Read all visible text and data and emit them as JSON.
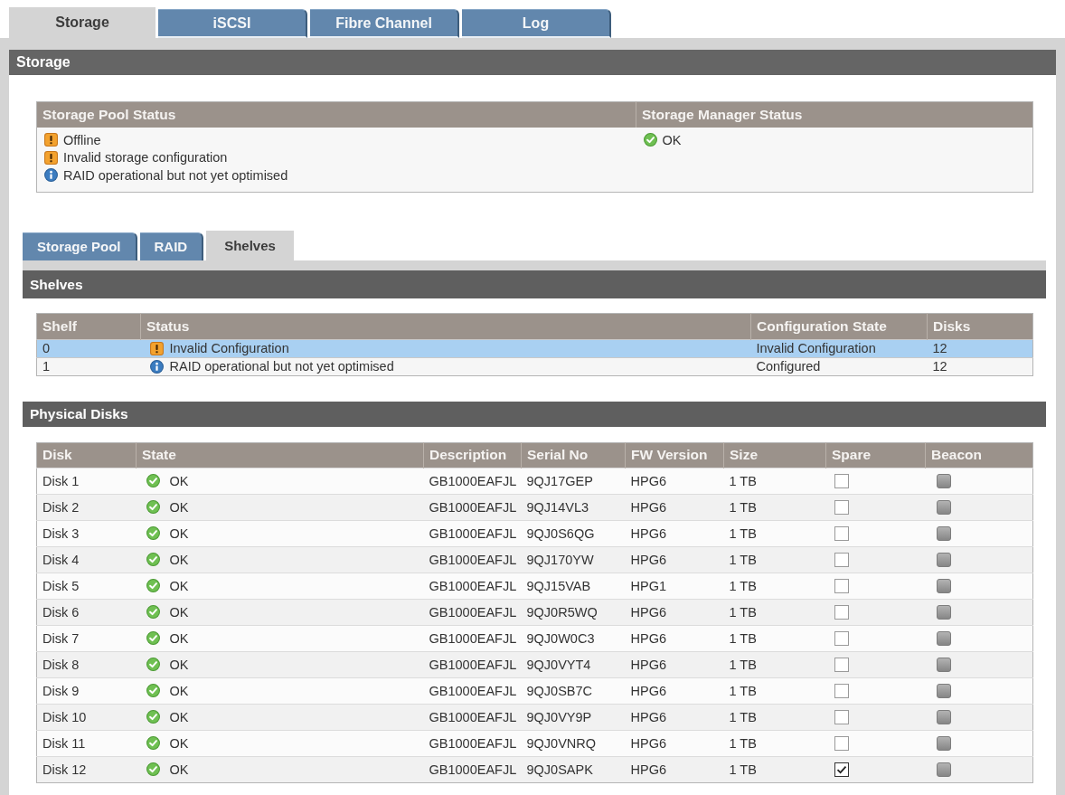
{
  "tabs": [
    {
      "label": "Storage",
      "selected": true
    },
    {
      "label": "iSCSI",
      "selected": false
    },
    {
      "label": "Fibre Channel",
      "selected": false
    },
    {
      "label": "Log",
      "selected": false
    }
  ],
  "section": {
    "title": "Storage"
  },
  "status_table": {
    "columns": [
      "Storage Pool Status",
      "Storage Manager Status"
    ],
    "pool_status": [
      {
        "kind": "warning",
        "text": "Offline"
      },
      {
        "kind": "warning",
        "text": "Invalid storage configuration"
      },
      {
        "kind": "info",
        "text": "RAID operational but not yet optimised"
      }
    ],
    "manager_status": [
      {
        "kind": "ok",
        "text": "OK"
      }
    ]
  },
  "sub_tabs": [
    {
      "label": "Storage Pool",
      "selected": false
    },
    {
      "label": "RAID",
      "selected": false
    },
    {
      "label": "Shelves",
      "selected": true
    }
  ],
  "shelves": {
    "title": "Shelves",
    "columns": [
      "Shelf",
      "Status",
      "Configuration State",
      "Disks"
    ],
    "rows": [
      {
        "shelf": "0",
        "status": {
          "kind": "warning",
          "text": "Invalid Configuration"
        },
        "configuration_state": "Invalid Configuration",
        "disks": "12",
        "selected": true
      },
      {
        "shelf": "1",
        "status": {
          "kind": "info",
          "text": "RAID operational but not yet optimised"
        },
        "configuration_state": "Configured",
        "disks": "12",
        "selected": false
      }
    ]
  },
  "physical_disks": {
    "title": "Physical Disks",
    "columns": [
      "Disk",
      "State",
      "Description",
      "Serial No",
      "FW Version",
      "Size",
      "Spare",
      "Beacon"
    ],
    "rows": [
      {
        "disk": "Disk 1",
        "state": {
          "kind": "ok",
          "text": "OK"
        },
        "description": "GB1000EAFJL",
        "serial_no": "9QJ17GEP",
        "fw_version": "HPG6",
        "size": "1 TB",
        "spare": false
      },
      {
        "disk": "Disk 2",
        "state": {
          "kind": "ok",
          "text": "OK"
        },
        "description": "GB1000EAFJL",
        "serial_no": "9QJ14VL3",
        "fw_version": "HPG6",
        "size": "1 TB",
        "spare": false
      },
      {
        "disk": "Disk 3",
        "state": {
          "kind": "ok",
          "text": "OK"
        },
        "description": "GB1000EAFJL",
        "serial_no": "9QJ0S6QG",
        "fw_version": "HPG6",
        "size": "1 TB",
        "spare": false
      },
      {
        "disk": "Disk 4",
        "state": {
          "kind": "ok",
          "text": "OK"
        },
        "description": "GB1000EAFJL",
        "serial_no": "9QJ170YW",
        "fw_version": "HPG6",
        "size": "1 TB",
        "spare": false
      },
      {
        "disk": "Disk 5",
        "state": {
          "kind": "ok",
          "text": "OK"
        },
        "description": "GB1000EAFJL",
        "serial_no": "9QJ15VAB",
        "fw_version": "HPG1",
        "size": "1 TB",
        "spare": false
      },
      {
        "disk": "Disk 6",
        "state": {
          "kind": "ok",
          "text": "OK"
        },
        "description": "GB1000EAFJL",
        "serial_no": "9QJ0R5WQ",
        "fw_version": "HPG6",
        "size": "1 TB",
        "spare": false
      },
      {
        "disk": "Disk 7",
        "state": {
          "kind": "ok",
          "text": "OK"
        },
        "description": "GB1000EAFJL",
        "serial_no": "9QJ0W0C3",
        "fw_version": "HPG6",
        "size": "1 TB",
        "spare": false
      },
      {
        "disk": "Disk 8",
        "state": {
          "kind": "ok",
          "text": "OK"
        },
        "description": "GB1000EAFJL",
        "serial_no": "9QJ0VYT4",
        "fw_version": "HPG6",
        "size": "1 TB",
        "spare": false
      },
      {
        "disk": "Disk 9",
        "state": {
          "kind": "ok",
          "text": "OK"
        },
        "description": "GB1000EAFJL",
        "serial_no": "9QJ0SB7C",
        "fw_version": "HPG6",
        "size": "1 TB",
        "spare": false
      },
      {
        "disk": "Disk 10",
        "state": {
          "kind": "ok",
          "text": "OK"
        },
        "description": "GB1000EAFJL",
        "serial_no": "9QJ0VY9P",
        "fw_version": "HPG6",
        "size": "1 TB",
        "spare": false
      },
      {
        "disk": "Disk 11",
        "state": {
          "kind": "ok",
          "text": "OK"
        },
        "description": "GB1000EAFJL",
        "serial_no": "9QJ0VNRQ",
        "fw_version": "HPG6",
        "size": "1 TB",
        "spare": false
      },
      {
        "disk": "Disk 12",
        "state": {
          "kind": "ok",
          "text": "OK"
        },
        "description": "GB1000EAFJL",
        "serial_no": "9QJ0SAPK",
        "fw_version": "HPG6",
        "size": "1 TB",
        "spare": true
      }
    ]
  }
}
